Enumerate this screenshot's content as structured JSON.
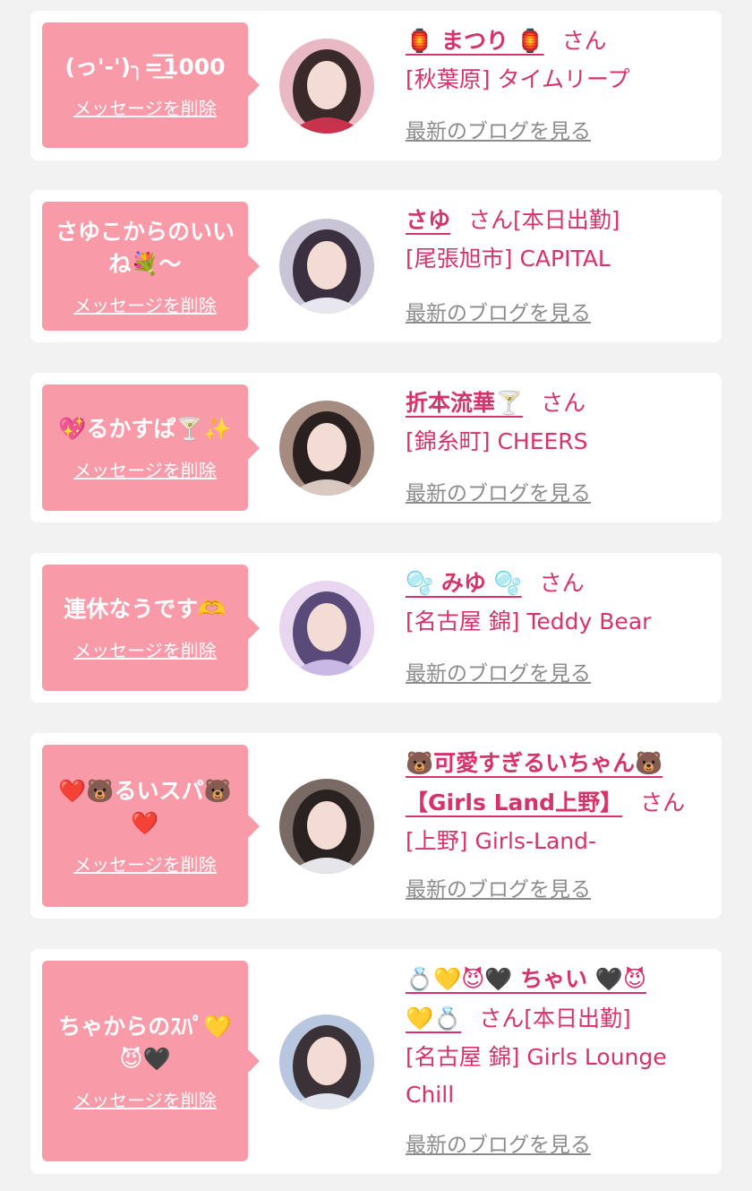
{
  "delete_label": "メッセージを削除",
  "blog_label": "最新のブログを見る",
  "colors": {
    "background": "#f2f2f2",
    "card": "#ffffff",
    "bubble": "#f99aa9",
    "name": "#d6336c",
    "link_gray": "#8c8c8c"
  },
  "cards": [
    {
      "message": "(っ'-')╮=͟͟͞͞1000",
      "name_lines": [
        "🏮 まつり 🏮"
      ],
      "honorific": "さん",
      "status": "",
      "shop": "[秋葉原] タイムリープ",
      "avatar_colors": [
        "#c8324a",
        "#e9b9c3",
        "#3a2a2a"
      ]
    },
    {
      "message": "さゆこからのいいね💐〜",
      "name_lines": [
        "さゆ"
      ],
      "honorific": "さん",
      "status": "[本日出勤]",
      "shop": "[尾張旭市] CAPITAL",
      "avatar_colors": [
        "#e8e6ee",
        "#c9c4d6",
        "#3b3040"
      ]
    },
    {
      "message": "💖るかすぱ🍸✨",
      "name_lines": [
        "折本流華🍸"
      ],
      "honorific": "さん",
      "status": "",
      "shop": "[錦糸町] CHEERS",
      "avatar_colors": [
        "#d9c8c0",
        "#a58b80",
        "#2a2020"
      ]
    },
    {
      "message": "連休なうです🫶",
      "name_lines": [
        "🫧 みゆ 🫧"
      ],
      "honorific": "さん",
      "status": "",
      "shop": "[名古屋 錦] Teddy Bear",
      "avatar_colors": [
        "#c9b8e6",
        "#e8d6f0",
        "#5a4a7a"
      ]
    },
    {
      "message": "❤️🐻るいスパ🐻❤️",
      "name_lines": [
        "🐻可愛すぎるいちゃん🐻",
        "【Girls Land上野】"
      ],
      "honorific": "さん",
      "status": "",
      "shop": "[上野] Girls-Land-",
      "avatar_colors": [
        "#e6e6ea",
        "#7a6a66",
        "#2a2220"
      ]
    },
    {
      "message": "ちゃからのｽﾊﾟ💛😈🖤",
      "name_lines": [
        "💍💛😈🖤 ちゃい 🖤😈",
        "💛💍"
      ],
      "honorific": "さん",
      "status": "[本日出勤]",
      "shop": "[名古屋 錦] Girls Lounge Chill",
      "avatar_colors": [
        "#dfe4ee",
        "#b9c6e0",
        "#3a3236"
      ]
    }
  ]
}
